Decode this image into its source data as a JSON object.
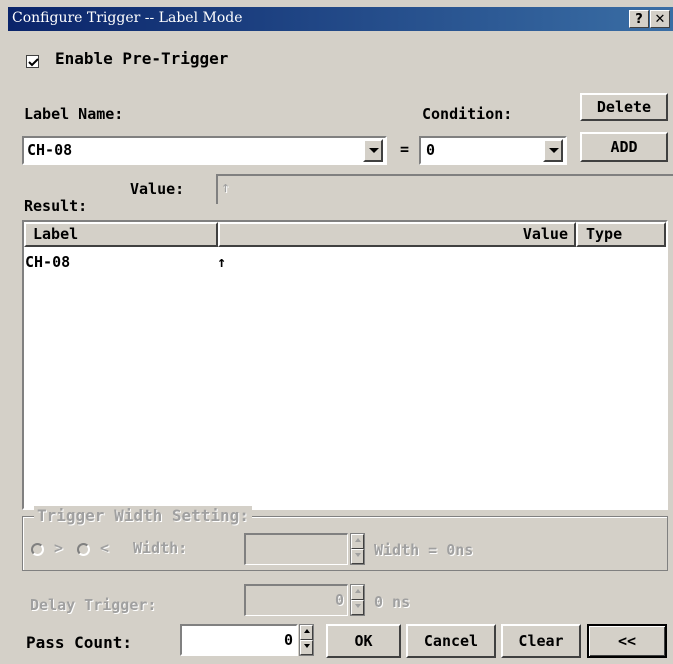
{
  "window": {
    "title": "Configure Trigger -- Label Mode",
    "help_button": "?",
    "close_button": "✕"
  },
  "pre_trigger": {
    "label": "Enable Pre-Trigger",
    "checked": true
  },
  "label_name": {
    "label": "Label Name:",
    "value": "CH-08"
  },
  "equals": "=",
  "condition": {
    "label": "Condition:",
    "value": "0"
  },
  "buttons": {
    "delete": "Delete",
    "add": "ADD",
    "ok": "OK",
    "cancel": "Cancel",
    "clear": "Clear",
    "collapse": "<<"
  },
  "value_field": {
    "label": "Value:",
    "value": "↑"
  },
  "result": {
    "label": "Result:",
    "columns": [
      "Label",
      "Value",
      "Type"
    ],
    "rows": [
      {
        "label": "CH-08",
        "value": "↑",
        "type": ""
      }
    ]
  },
  "trigger_width": {
    "group_label": "Trigger Width Setting:",
    "radio_greater": ">",
    "radio_less": "<",
    "width_label": "Width:",
    "width_value": "",
    "width_readout": "Width = 0ns"
  },
  "delay_trigger": {
    "label": "Delay Trigger:",
    "value": "0",
    "unit": "0 ns"
  },
  "pass_count": {
    "label": "Pass Count:",
    "value": "0"
  }
}
